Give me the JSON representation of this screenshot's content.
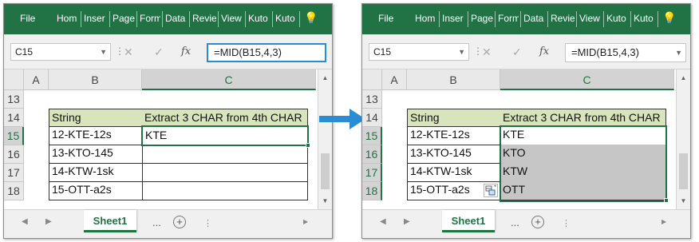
{
  "ribbon_tabs": [
    "File",
    "Hom",
    "Inser",
    "Page",
    "Form",
    "Data",
    "Revie",
    "View",
    "Kuto",
    "Kuto"
  ],
  "left": {
    "namebox": "C15",
    "formula": "=MID(B15,4,3)"
  },
  "right": {
    "namebox": "C15",
    "formula": "=MID(B15,4,3)"
  },
  "icons": {
    "cancel": "✕",
    "enter": "✓",
    "fx": "fx",
    "bulb": "💡"
  },
  "columns": [
    "A",
    "B",
    "C"
  ],
  "rows": [
    "13",
    "14",
    "15",
    "16",
    "17",
    "18"
  ],
  "headers": {
    "string": "String",
    "extract": "Extract 3 CHAR from 4th CHAR"
  },
  "strings": [
    "12-KTE-12s",
    "13-KTO-145",
    "14-KTW-1sk",
    "15-OTT-a2s"
  ],
  "left_results": [
    "KTE",
    "",
    "",
    ""
  ],
  "right_results": [
    "KTE",
    "KTO",
    "KTW",
    "OTT"
  ],
  "sheet": {
    "name": "Sheet1",
    "more": "...",
    "add": "+"
  },
  "colors": {
    "excel_green": "#217346",
    "header_fill": "#d7e4bc",
    "selection": "#c6c6c6",
    "arrow": "#2b8cd6"
  }
}
